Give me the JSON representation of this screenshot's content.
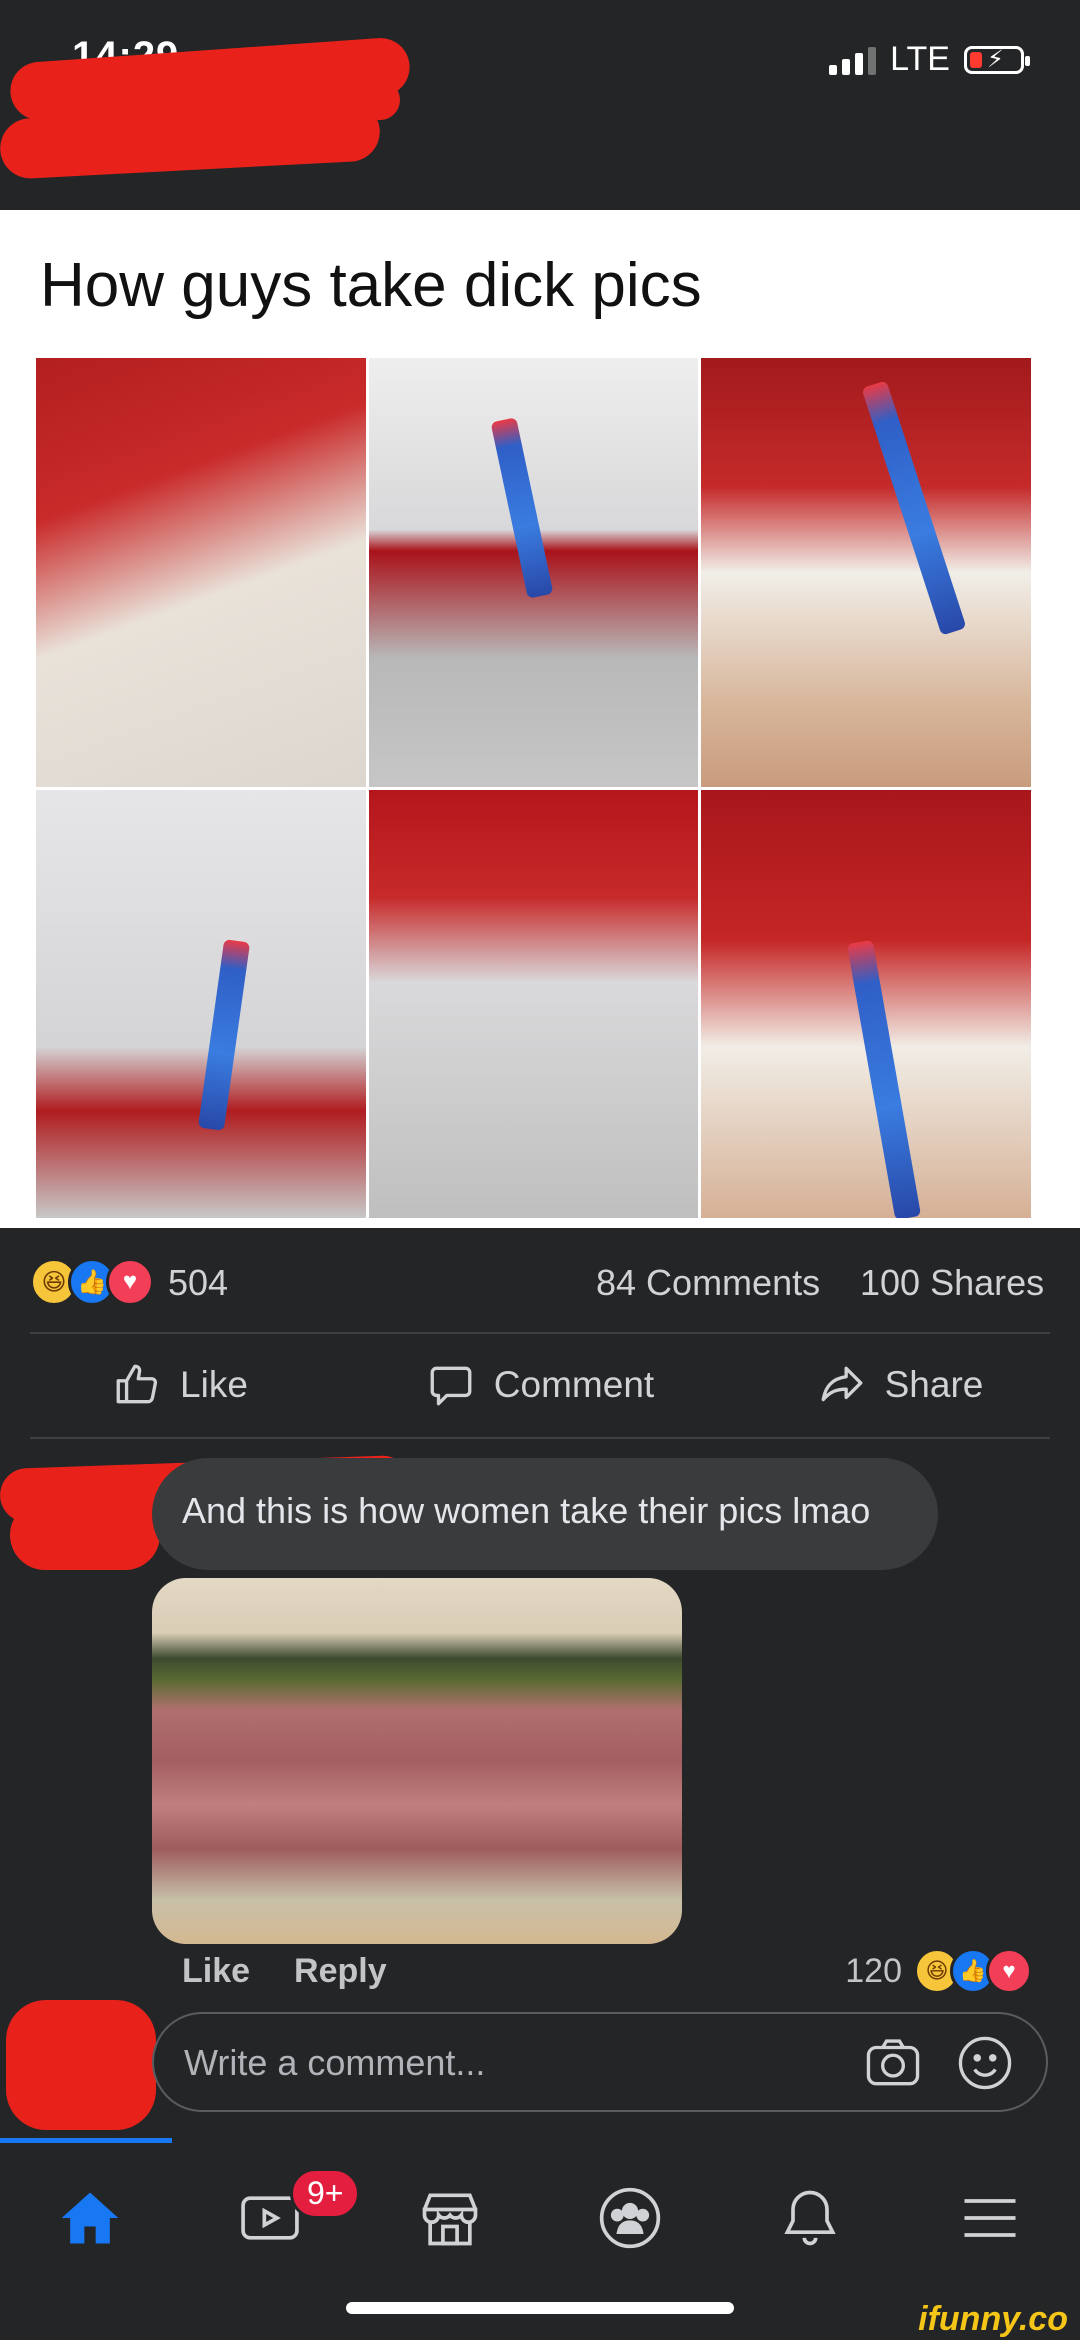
{
  "status_bar": {
    "time": "14:29",
    "network": "LTE"
  },
  "post": {
    "caption": "How guys take dick pics",
    "reaction_count": "504",
    "comments_count": "84 Comments",
    "shares_count": "100 Shares",
    "reactions": [
      "haha",
      "like",
      "love"
    ]
  },
  "actions": {
    "like": "Like",
    "comment": "Comment",
    "share": "Share"
  },
  "comment": {
    "text": "And this is how women take their pics lmao",
    "like_label": "Like",
    "reply_label": "Reply",
    "reaction_count": "120",
    "reactions": [
      "haha",
      "like",
      "love"
    ]
  },
  "composer": {
    "placeholder": "Write a comment..."
  },
  "bottom_nav": {
    "items": [
      "home-icon",
      "watch-icon",
      "marketplace-icon",
      "groups-icon",
      "notifications-icon",
      "menu-icon"
    ],
    "watch_badge": "9+"
  },
  "watermark": "ifunny.co",
  "colors": {
    "background": "#242526",
    "accent": "#1877f2",
    "redaction": "#e8221b",
    "badge": "#e41e3f"
  }
}
